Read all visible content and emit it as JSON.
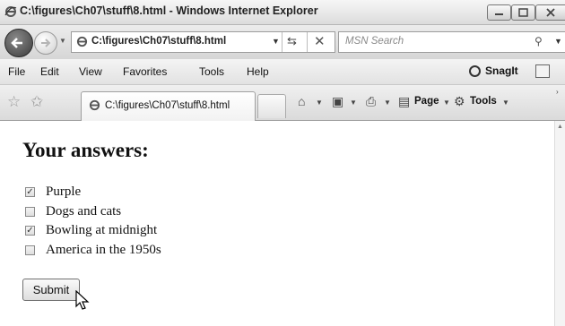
{
  "window": {
    "title": "C:\\figures\\Ch07\\stuff\\8.html - Windows Internet Explorer"
  },
  "address_bar": {
    "url": "C:\\figures\\Ch07\\stuff\\8.html",
    "search_placeholder": "MSN Search"
  },
  "menu": {
    "items": [
      "File",
      "Edit",
      "View",
      "Favorites",
      "Tools",
      "Help"
    ],
    "snagit_label": "SnagIt"
  },
  "tabs": {
    "active_label": "C:\\figures\\Ch07\\stuff\\8.html"
  },
  "commands": {
    "page_label": "Page",
    "tools_label": "Tools"
  },
  "page": {
    "heading": "Your answers:",
    "answers": [
      {
        "label": "Purple",
        "checked": true
      },
      {
        "label": "Dogs and cats",
        "checked": false
      },
      {
        "label": "Bowling at midnight",
        "checked": true
      },
      {
        "label": "America in the 1950s",
        "checked": false
      }
    ],
    "submit_label": "Submit"
  },
  "colors": {
    "chrome_background": "#dcdcdc",
    "page_background": "#ffffff"
  }
}
